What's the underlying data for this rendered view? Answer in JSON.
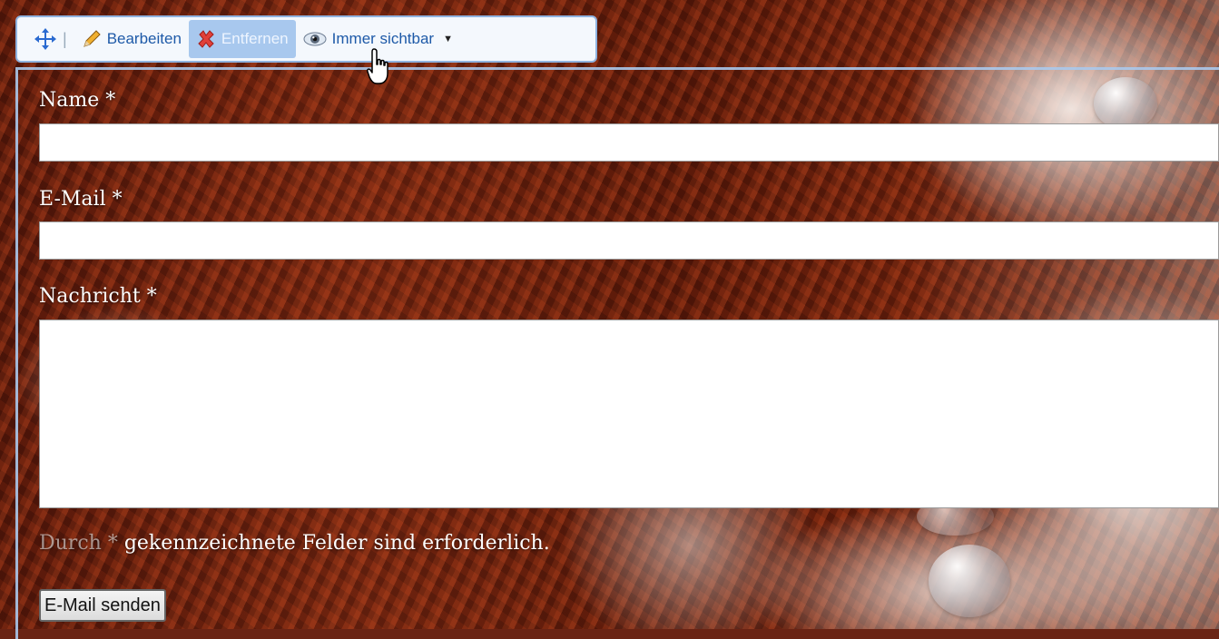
{
  "toolbar": {
    "edit_label": "Bearbeiten",
    "remove_label": "Entfernen",
    "visibility_label": "Immer sichtbar",
    "separator": "|"
  },
  "form": {
    "name_label": "Name",
    "email_label": "E-Mail",
    "message_label": "Nachricht",
    "required_marker": "*",
    "name_value": "",
    "email_value": "",
    "message_value": "",
    "note_prefix": "Durch",
    "note_rest": "gekennzeichnete Felder sind erforderlich.",
    "submit_label": "E-Mail senden"
  },
  "colors": {
    "toolbar_text": "#1e5aa8",
    "toolbar_active_bg": "#a8c8ee",
    "remove_icon": "#e0403a"
  }
}
